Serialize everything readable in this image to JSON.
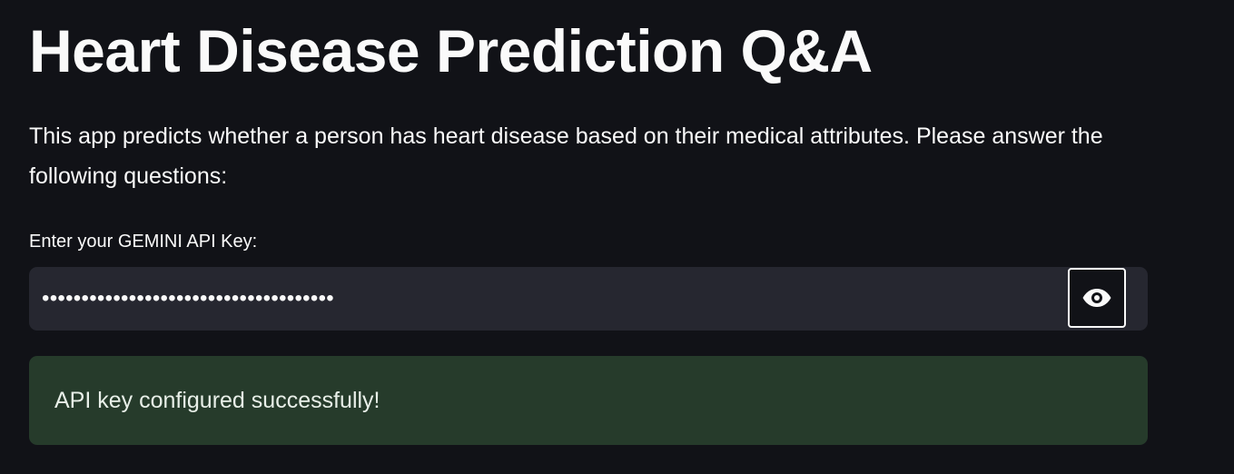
{
  "header": {
    "title": "Heart Disease Prediction Q&A"
  },
  "intro": {
    "text": "This app predicts whether a person has heart disease based on their medical attributes. Please answer the following questions:"
  },
  "api_key": {
    "label": "Enter your GEMINI API Key:",
    "value": "•••••••••••••••••••••••••••••••••••••",
    "toggle_icon": "eye-icon"
  },
  "alert": {
    "message": "API key configured successfully!",
    "status": "success",
    "color": "#263b2b"
  },
  "colors": {
    "background": "#111217",
    "input_background": "#262730",
    "text": "#fafafa"
  }
}
